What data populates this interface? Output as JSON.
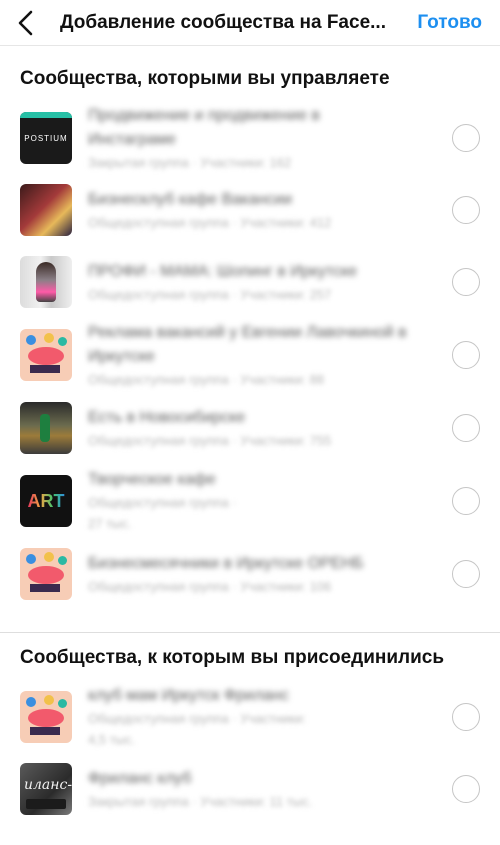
{
  "header": {
    "title": "Добавление сообщества на Face...",
    "done": "Готово"
  },
  "sections": [
    {
      "title": "Сообщества, которыми вы управляете"
    },
    {
      "title": "Сообщества, к которым вы присоединились"
    }
  ],
  "managed": [
    {
      "thumb_text": "POSTIUM",
      "line1": "Продвижение и продвижение в",
      "line2": "Инстаграме",
      "sub": "Закрытая группа · Участники: 162"
    },
    {
      "line1": "Бизнесклуб кафе Вакансии",
      "sub": "Общедоступная группа · Участники: 412"
    },
    {
      "line1": "ПРОФИ - МАМА: Шопинг в Иркутске",
      "sub": "Общедоступная группа · Участники: 257"
    },
    {
      "line1": "Реклама вакансий у Евгении Лавочкиной в",
      "line2": "Иркутске",
      "sub": "Общедоступная группа · Участники: 88"
    },
    {
      "line1": "Есть в Новосибирске",
      "sub": "Общедоступная группа · Участники: 755"
    },
    {
      "thumb_text": "ART",
      "line1": "Творческое кафе",
      "line2": "Общедоступная группа ·",
      "sub": "27 тыс."
    },
    {
      "line1": "Бизнесмесячники в Иркутске ОРЕНБ",
      "sub": "Общедоступная группа · Участники: 106"
    }
  ],
  "joined": [
    {
      "line1": "клуб мам Иркутск Фриланс",
      "line2": "Общедоступная группа · Участники:",
      "sub": "4,5 тыс."
    },
    {
      "thumb_text": "иланс-",
      "line1": "Фриланс клуб",
      "sub": "Закрытая группа · Участники: 11 тыс."
    }
  ],
  "colors": {
    "accent": "#1d8ff0"
  },
  "icons": {
    "back": "chevron-left-icon"
  }
}
